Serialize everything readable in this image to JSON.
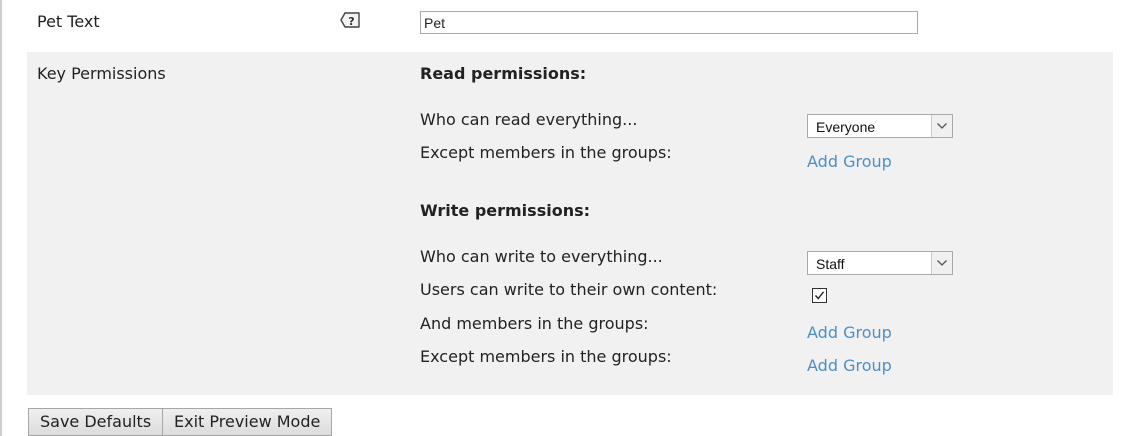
{
  "pet_text": {
    "label": "Pet Text",
    "help_icon": "help-bubble-icon",
    "value": "Pet"
  },
  "key_permissions": {
    "label": "Key Permissions",
    "read": {
      "heading": "Read permissions:",
      "who_label": "Who can read everything...",
      "who_value": "Everyone",
      "except_label": "Except members in the groups:",
      "except_link": "Add Group"
    },
    "write": {
      "heading": "Write permissions:",
      "who_label": "Who can write to everything...",
      "who_value": "Staff",
      "own_label": "Users can write to their own content:",
      "own_checked": true,
      "and_label": "And members in the groups:",
      "and_link": "Add Group",
      "except_label": "Except members in the groups:",
      "except_link": "Add Group"
    }
  },
  "buttons": {
    "save_defaults": "Save Defaults",
    "exit_preview": "Exit Preview Mode"
  },
  "colors": {
    "link": "#4a90c8",
    "row_background": "#f1f1f1"
  }
}
